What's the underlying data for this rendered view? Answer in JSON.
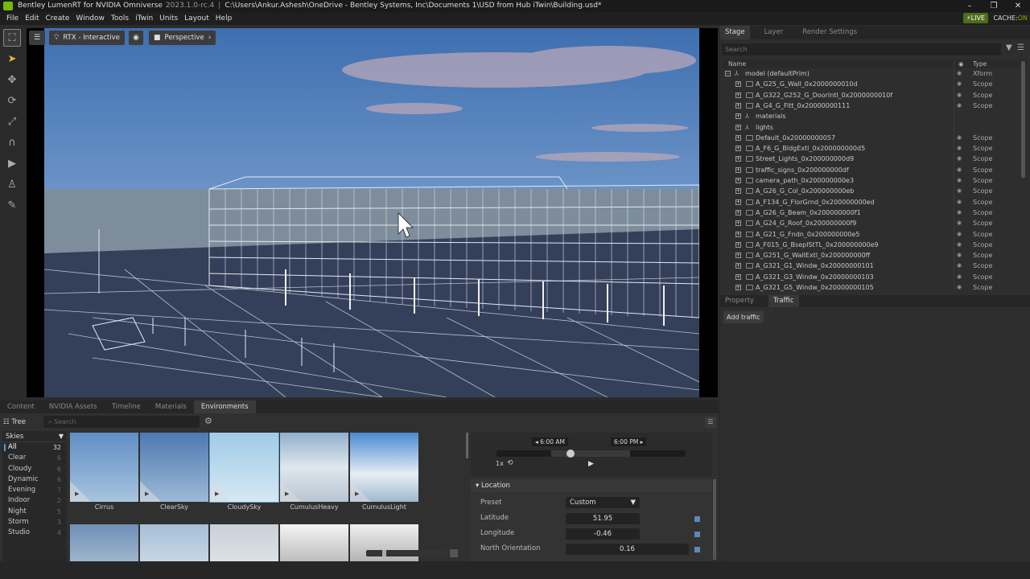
{
  "window": {
    "app_title": "Bentley LumenRT for NVIDIA Omniverse",
    "version": "2023.1.0-rc.4",
    "path": "C:\\Users\\Ankur.Ashesh\\OneDrive - Bentley Systems, Inc\\Documents 1\\USD from Hub iTwin\\Building.usd*",
    "minimize": "–",
    "restore": "❐",
    "close": "✕"
  },
  "menu": [
    "File",
    "Edit",
    "Create",
    "Window",
    "Tools",
    "iTwin",
    "Units",
    "Layout",
    "Help"
  ],
  "live": {
    "label": "LIVE",
    "cache_label": "CACHE:",
    "cache_state": "ON"
  },
  "viewport": {
    "render_mode": "RTX - Interactive",
    "camera": "Perspective"
  },
  "bottom_tabs": [
    "Content",
    "NVIDIA Assets",
    "Timeline",
    "Materials",
    "Environments"
  ],
  "environments": {
    "tree_label": "Tree",
    "search_placeholder": "Search",
    "category_header": "Skies",
    "categories": [
      {
        "name": "All",
        "count": "32"
      },
      {
        "name": "Clear",
        "count": "6"
      },
      {
        "name": "Cloudy",
        "count": "6"
      },
      {
        "name": "Dynamic",
        "count": "6"
      },
      {
        "name": "Evening",
        "count": "7"
      },
      {
        "name": "Indoor",
        "count": "2"
      },
      {
        "name": "Night",
        "count": "5"
      },
      {
        "name": "Storm",
        "count": "3"
      },
      {
        "name": "Studio",
        "count": "4"
      }
    ],
    "thumbnails": [
      "Cirrus",
      "ClearSky",
      "CloudySky",
      "CumulusHeavy",
      "CumulusLight"
    ],
    "selected_thumbnail": "CloudySky"
  },
  "time": {
    "start": "6:00 AM",
    "end": "6:00 PM",
    "speed": "1x",
    "slider_position": 0.39
  },
  "location": {
    "header": "Location",
    "preset_label": "Preset",
    "preset_value": "Custom",
    "latitude_label": "Latitude",
    "latitude": "51.95",
    "longitude_label": "Longitude",
    "longitude": "-0.46",
    "north_label": "North Orientation",
    "north": "0.16"
  },
  "stage": {
    "tabs": [
      "Stage",
      "Layer",
      "Render Settings"
    ],
    "search_placeholder": "Search",
    "col_name": "Name",
    "col_type": "Type",
    "rows": [
      {
        "name": "model (defaultPrim)",
        "type": "Xform",
        "level": 0,
        "icon": "xform",
        "eye": true
      },
      {
        "name": "A_G25_G_Wall_0x2000000010d",
        "type": "Scope",
        "level": 1,
        "icon": "folder",
        "eye": true
      },
      {
        "name": "A_G322_G252_G_DoorIntl_0x2000000010f",
        "type": "Scope",
        "level": 1,
        "icon": "folder",
        "eye": true
      },
      {
        "name": "A_G4_G_Fitt_0x20000000111",
        "type": "Scope",
        "level": 1,
        "icon": "folder",
        "eye": true
      },
      {
        "name": "materials",
        "type": "",
        "level": 1,
        "icon": "xform",
        "eye": false
      },
      {
        "name": "lights",
        "type": "",
        "level": 1,
        "icon": "xform",
        "eye": false
      },
      {
        "name": "Default_0x20000000057",
        "type": "Scope",
        "level": 1,
        "icon": "folder",
        "eye": true
      },
      {
        "name": "A_F6_G_BldgExtl_0x200000000d5",
        "type": "Scope",
        "level": 1,
        "icon": "folder",
        "eye": true
      },
      {
        "name": "Street_Lights_0x200000000d9",
        "type": "Scope",
        "level": 1,
        "icon": "folder",
        "eye": true
      },
      {
        "name": "traffic_signs_0x200000000df",
        "type": "Scope",
        "level": 1,
        "icon": "folder",
        "eye": true
      },
      {
        "name": "camera_path_0x200000000e3",
        "type": "Scope",
        "level": 1,
        "icon": "folder",
        "eye": true
      },
      {
        "name": "A_G26_G_Col_0x200000000eb",
        "type": "Scope",
        "level": 1,
        "icon": "folder",
        "eye": true
      },
      {
        "name": "A_F134_G_FlorGrnd_0x200000000ed",
        "type": "Scope",
        "level": 1,
        "icon": "folder",
        "eye": true
      },
      {
        "name": "A_G26_G_Beam_0x200000000f1",
        "type": "Scope",
        "level": 1,
        "icon": "folder",
        "eye": true
      },
      {
        "name": "A_G24_G_Roof_0x200000000f9",
        "type": "Scope",
        "level": 1,
        "icon": "folder",
        "eye": true
      },
      {
        "name": "A_G21_G_Fndn_0x200000000e5",
        "type": "Scope",
        "level": 1,
        "icon": "folder",
        "eye": true
      },
      {
        "name": "A_F015_G_BseplStTL_0x200000000e9",
        "type": "Scope",
        "level": 1,
        "icon": "folder",
        "eye": true
      },
      {
        "name": "A_G251_G_WallExtl_0x200000000ff",
        "type": "Scope",
        "level": 1,
        "icon": "folder",
        "eye": true
      },
      {
        "name": "A_G321_G1_Windw_0x20000000101",
        "type": "Scope",
        "level": 1,
        "icon": "folder",
        "eye": true
      },
      {
        "name": "A_G321_G3_Windw_0x20000000103",
        "type": "Scope",
        "level": 1,
        "icon": "folder",
        "eye": true
      },
      {
        "name": "A_G321_G5_Windw_0x20000000105",
        "type": "Scope",
        "level": 1,
        "icon": "folder",
        "eye": true
      }
    ]
  },
  "property": {
    "tabs": [
      "Property",
      "Traffic"
    ],
    "active_tab": "Traffic",
    "add_traffic": "Add traffic"
  },
  "colors": {
    "accent": "#76b900",
    "selection": "#4a9fd8"
  }
}
